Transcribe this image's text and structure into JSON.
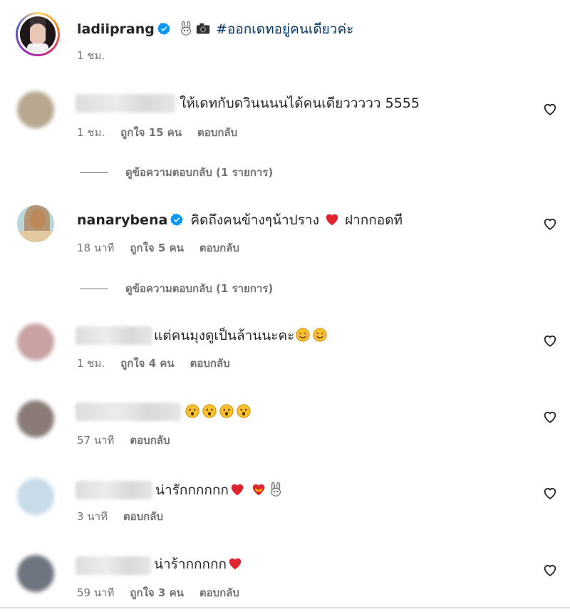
{
  "caption": {
    "username": "ladiiprang",
    "text": "🐰📷",
    "hashtag": "#ออกเดทอยู่คนเดียวค่ะ",
    "time": "1 ชม."
  },
  "comments": [
    {
      "username": "",
      "text": "ให้เดทกับดวินนนนได้คนเดียววววว 5555",
      "time": "1 ชม.",
      "likes": "ถูกใจ 15 คน",
      "reply_label": "ตอบกลับ",
      "view_replies": "ดูข้อความตอบกลับ (1 รายการ)"
    },
    {
      "username": "nanarybena",
      "text": "คิดถึงคนข้างๆน้าปราง",
      "text_after": "ฝากกอดที",
      "time": "18 นาที",
      "likes": "ถูกใจ 5 คน",
      "reply_label": "ตอบกลับ",
      "view_replies": "ดูข้อความตอบกลับ (1 รายการ)"
    },
    {
      "username": "",
      "text": "แต่คนมุงดูเป็นล้านนะคะ",
      "time": "1 ชม.",
      "likes": "ถูกใจ 4 คน",
      "reply_label": "ตอบกลับ"
    },
    {
      "username": "",
      "text": "",
      "time": "57 นาที",
      "reply_label": "ตอบกลับ"
    },
    {
      "username": "",
      "text": "น่ารักกกกกก",
      "time": "3 นาที",
      "reply_label": "ตอบกลับ"
    },
    {
      "username": "",
      "text": "น่าร้ากกกกก",
      "time": "59 นาที",
      "likes": "ถูกใจ 3 คน",
      "reply_label": "ตอบกลับ"
    }
  ],
  "colors": {
    "link": "#00376b",
    "meta": "#737373",
    "text": "#262626",
    "verified": "#0095f6"
  },
  "icons": [
    "verified-badge-icon",
    "heart-outline-icon",
    "rabbit-emoji",
    "camera-emoji",
    "red-heart-emoji",
    "smiling-face-emoji",
    "astonished-face-emoji",
    "heart-with-ribbon-emoji"
  ]
}
